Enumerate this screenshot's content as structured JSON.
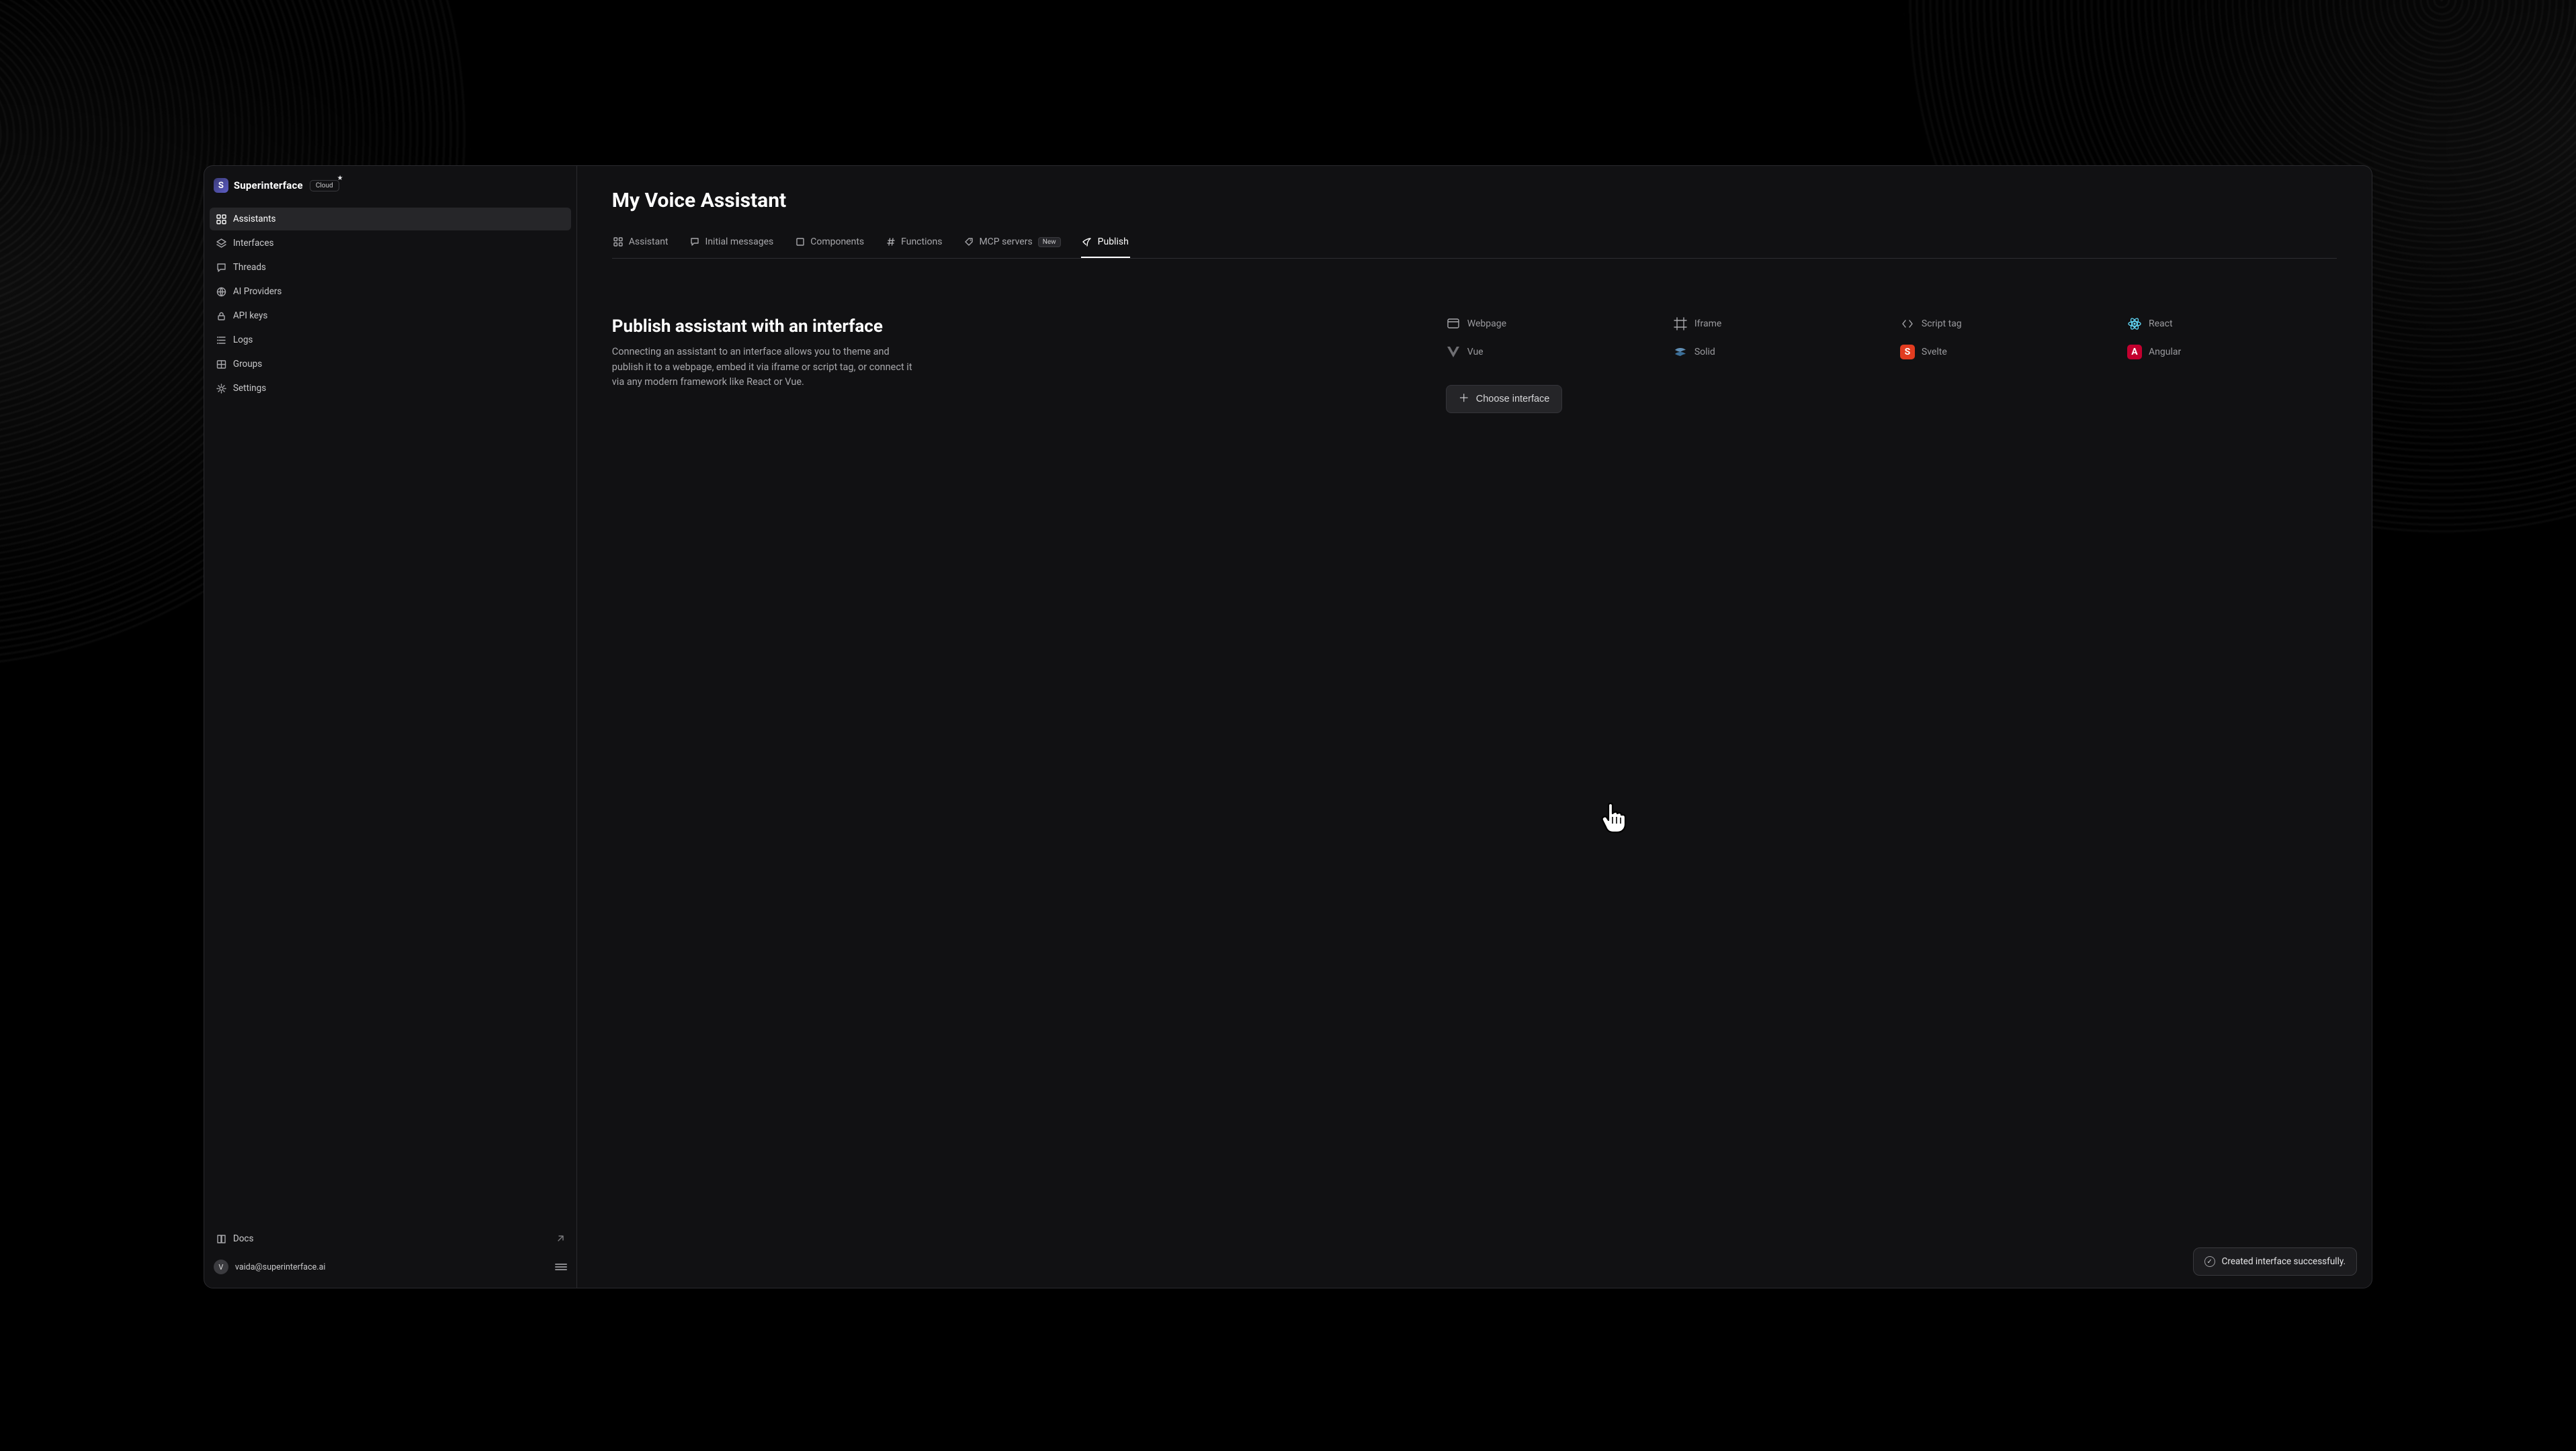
{
  "brand": {
    "name": "Superinterface",
    "badge": "Cloud",
    "logo_letter": "S"
  },
  "sidebar": {
    "items": [
      {
        "label": "Assistants",
        "icon": "grid-icon",
        "active": true
      },
      {
        "label": "Interfaces",
        "icon": "layers-icon",
        "active": false
      },
      {
        "label": "Threads",
        "icon": "chat-icon",
        "active": false
      },
      {
        "label": "AI Providers",
        "icon": "globe-icon",
        "active": false
      },
      {
        "label": "API keys",
        "icon": "lock-icon",
        "active": false
      },
      {
        "label": "Logs",
        "icon": "list-icon",
        "active": false
      },
      {
        "label": "Groups",
        "icon": "table-icon",
        "active": false
      },
      {
        "label": "Settings",
        "icon": "gear-icon",
        "active": false
      }
    ]
  },
  "docs_label": "Docs",
  "account": {
    "avatar_letter": "V",
    "email": "vaida@superinterface.ai"
  },
  "page": {
    "title": "My Voice Assistant"
  },
  "tabs": [
    {
      "label": "Assistant",
      "icon": "grid-icon"
    },
    {
      "label": "Initial messages",
      "icon": "chat-icon"
    },
    {
      "label": "Components",
      "icon": "square-icon"
    },
    {
      "label": "Functions",
      "icon": "hash-icon"
    },
    {
      "label": "MCP servers",
      "icon": "tag-icon",
      "badge": "New"
    },
    {
      "label": "Publish",
      "icon": "rocket-icon",
      "active": true
    }
  ],
  "intro": {
    "heading": "Publish assistant with an interface",
    "body": "Connecting an assistant to an interface allows you to theme and publish it to a webpage, embed it via iframe or script tag, or connect it via any modern framework like React or Vue."
  },
  "publish_options": [
    {
      "label": "Webpage",
      "icon": "webpage-icon"
    },
    {
      "label": "Iframe",
      "icon": "frame-icon"
    },
    {
      "label": "Script tag",
      "icon": "code-icon"
    },
    {
      "label": "React",
      "icon": "react-icon"
    },
    {
      "label": "Vue",
      "icon": "vue-icon"
    },
    {
      "label": "Solid",
      "icon": "solid-icon"
    },
    {
      "label": "Svelte",
      "icon": "svelte-icon"
    },
    {
      "label": "Angular",
      "icon": "angular-icon"
    }
  ],
  "choose_button": "Choose interface",
  "toast": {
    "message": "Created interface successfully."
  }
}
